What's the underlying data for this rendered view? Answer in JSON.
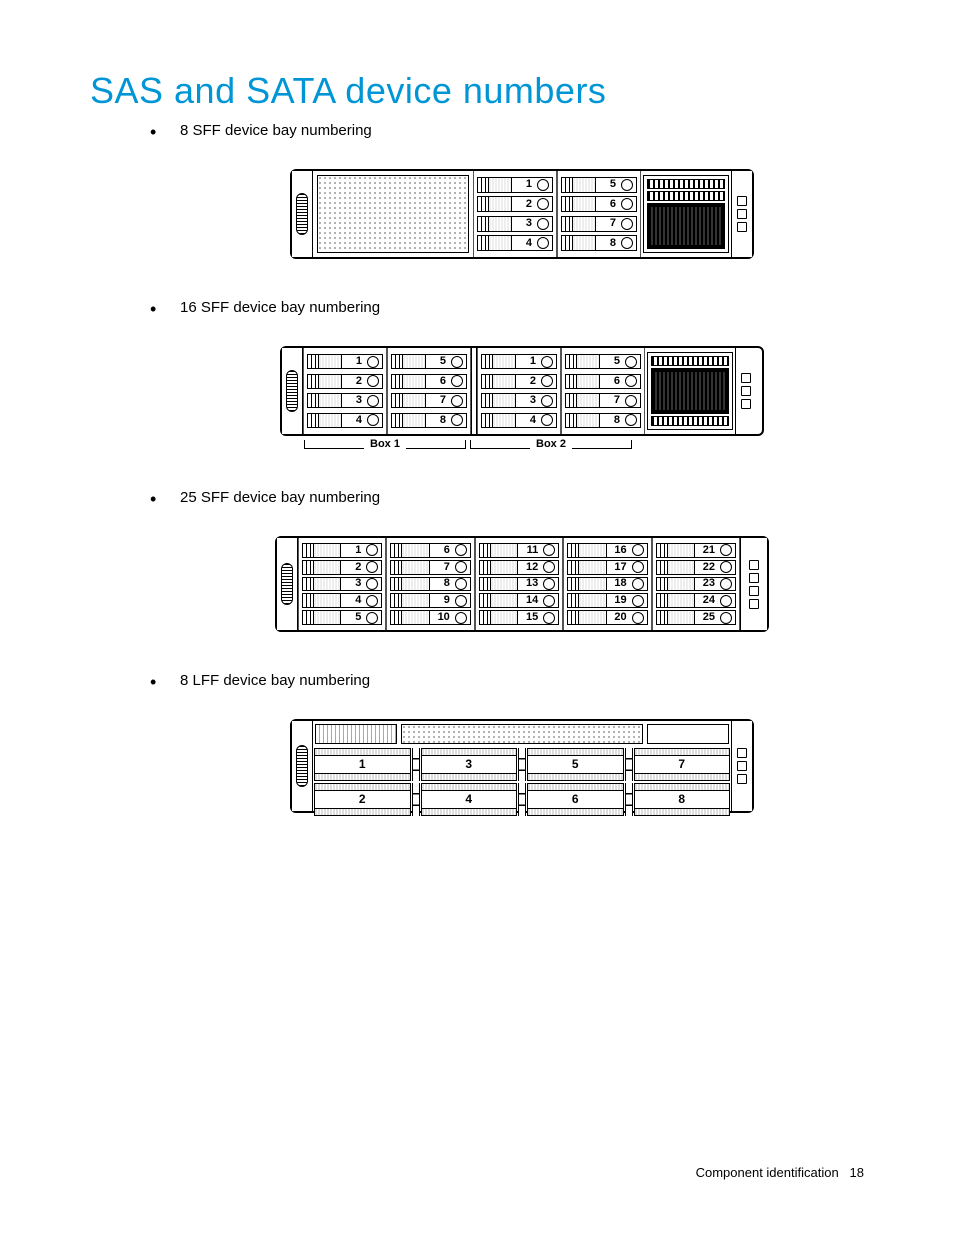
{
  "heading": "SAS and SATA device numbers",
  "items": [
    {
      "label": "8 SFF device bay numbering"
    },
    {
      "label": "16 SFF device bay numbering"
    },
    {
      "label": "25 SFF device bay numbering"
    },
    {
      "label": "8 LFF device bay numbering"
    }
  ],
  "diagrams": {
    "sff8": {
      "cols": [
        [
          1,
          2,
          3,
          4
        ],
        [
          5,
          6,
          7,
          8
        ]
      ]
    },
    "sff16": {
      "box1": [
        [
          1,
          2,
          3,
          4
        ],
        [
          5,
          6,
          7,
          8
        ]
      ],
      "box2": [
        [
          1,
          2,
          3,
          4
        ],
        [
          5,
          6,
          7,
          8
        ]
      ],
      "labels": {
        "box1": "Box 1",
        "box2": "Box 2"
      }
    },
    "sff25": {
      "cols": [
        [
          1,
          2,
          3,
          4,
          5
        ],
        [
          6,
          7,
          8,
          9,
          10
        ],
        [
          11,
          12,
          13,
          14,
          15
        ],
        [
          16,
          17,
          18,
          19,
          20
        ],
        [
          21,
          22,
          23,
          24,
          25
        ]
      ]
    },
    "lff8": {
      "top": [
        1,
        3,
        5,
        7
      ],
      "bottom": [
        2,
        4,
        6,
        8
      ]
    }
  },
  "footer": {
    "section": "Component identification",
    "page": "18"
  }
}
